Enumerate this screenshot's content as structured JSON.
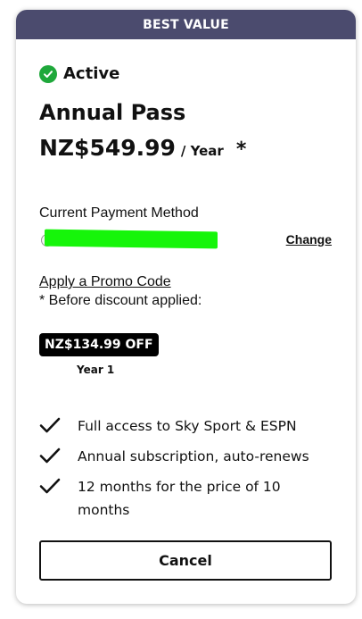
{
  "banner": {
    "label": "BEST VALUE",
    "color": "#4b4b6e"
  },
  "status": {
    "label": "Active",
    "icon": "check-circle-icon",
    "color": "#1fa83b"
  },
  "plan": {
    "name": "Annual Pass",
    "price": "NZ$549.99",
    "period": "/ Year",
    "asterisk": "*"
  },
  "payment": {
    "label": "Current Payment Method",
    "change_label": "Change",
    "redaction_color": "#16f50a"
  },
  "promo": {
    "link_label": "Apply a Promo Code",
    "note": "* Before discount applied:"
  },
  "discount": {
    "badge": "NZ$134.99 OFF",
    "period": "Year 1"
  },
  "features": [
    {
      "label": "Full access to Sky Sport & ESPN",
      "icon": "check-icon"
    },
    {
      "label": "Annual subscription, auto-renews",
      "icon": "check-icon"
    },
    {
      "label": "12 months for the price of 10 months",
      "icon": "check-icon"
    }
  ],
  "actions": {
    "cancel_label": "Cancel"
  }
}
